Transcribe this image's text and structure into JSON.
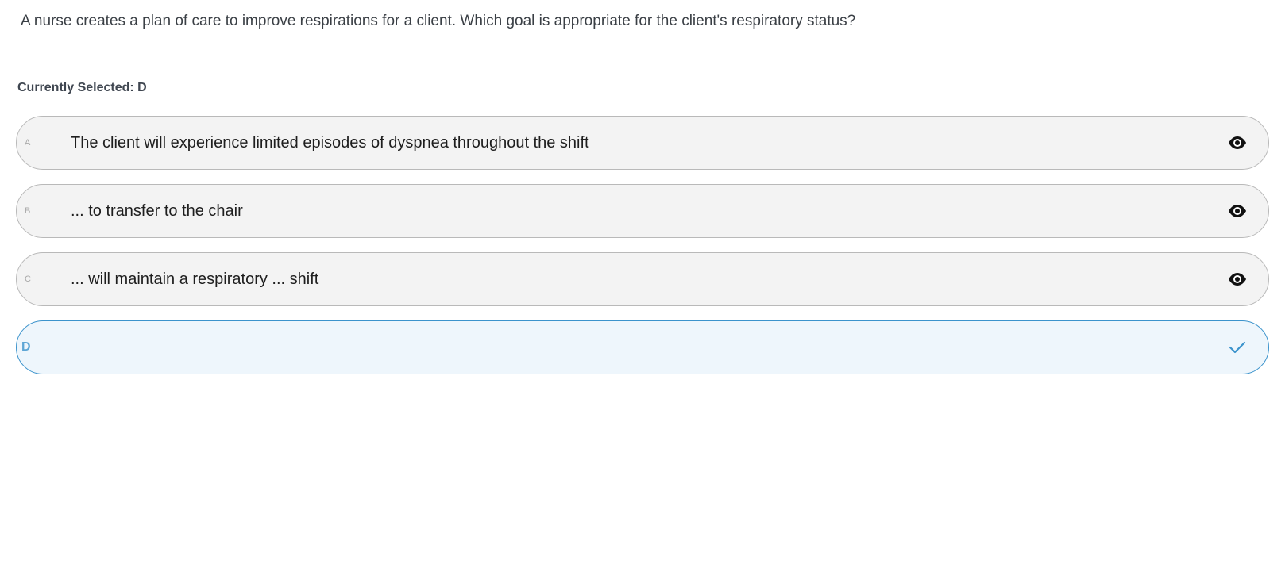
{
  "question": {
    "text": "A nurse creates a plan of care to improve respirations for a client. Which goal is appropriate for the client's respiratory status?"
  },
  "selection": {
    "label": "Currently Selected: D"
  },
  "options": [
    {
      "letter": "A",
      "text": "The client will experience limited episodes of dyspnea throughout the shift",
      "icon": "eye-icon"
    },
    {
      "letter": "B",
      "text": "... to transfer to the chair",
      "icon": "eye-icon"
    },
    {
      "letter": "C",
      "text": "... will maintain a respiratory ... shift",
      "icon": "eye-icon"
    },
    {
      "letter": "D",
      "text": "",
      "icon": "check-icon",
      "selected": true
    }
  ],
  "colors": {
    "accent": "#3b93cc",
    "selected_background": "#eef6fc",
    "option_background": "#f3f3f3",
    "option_border": "#b9b9b9"
  }
}
